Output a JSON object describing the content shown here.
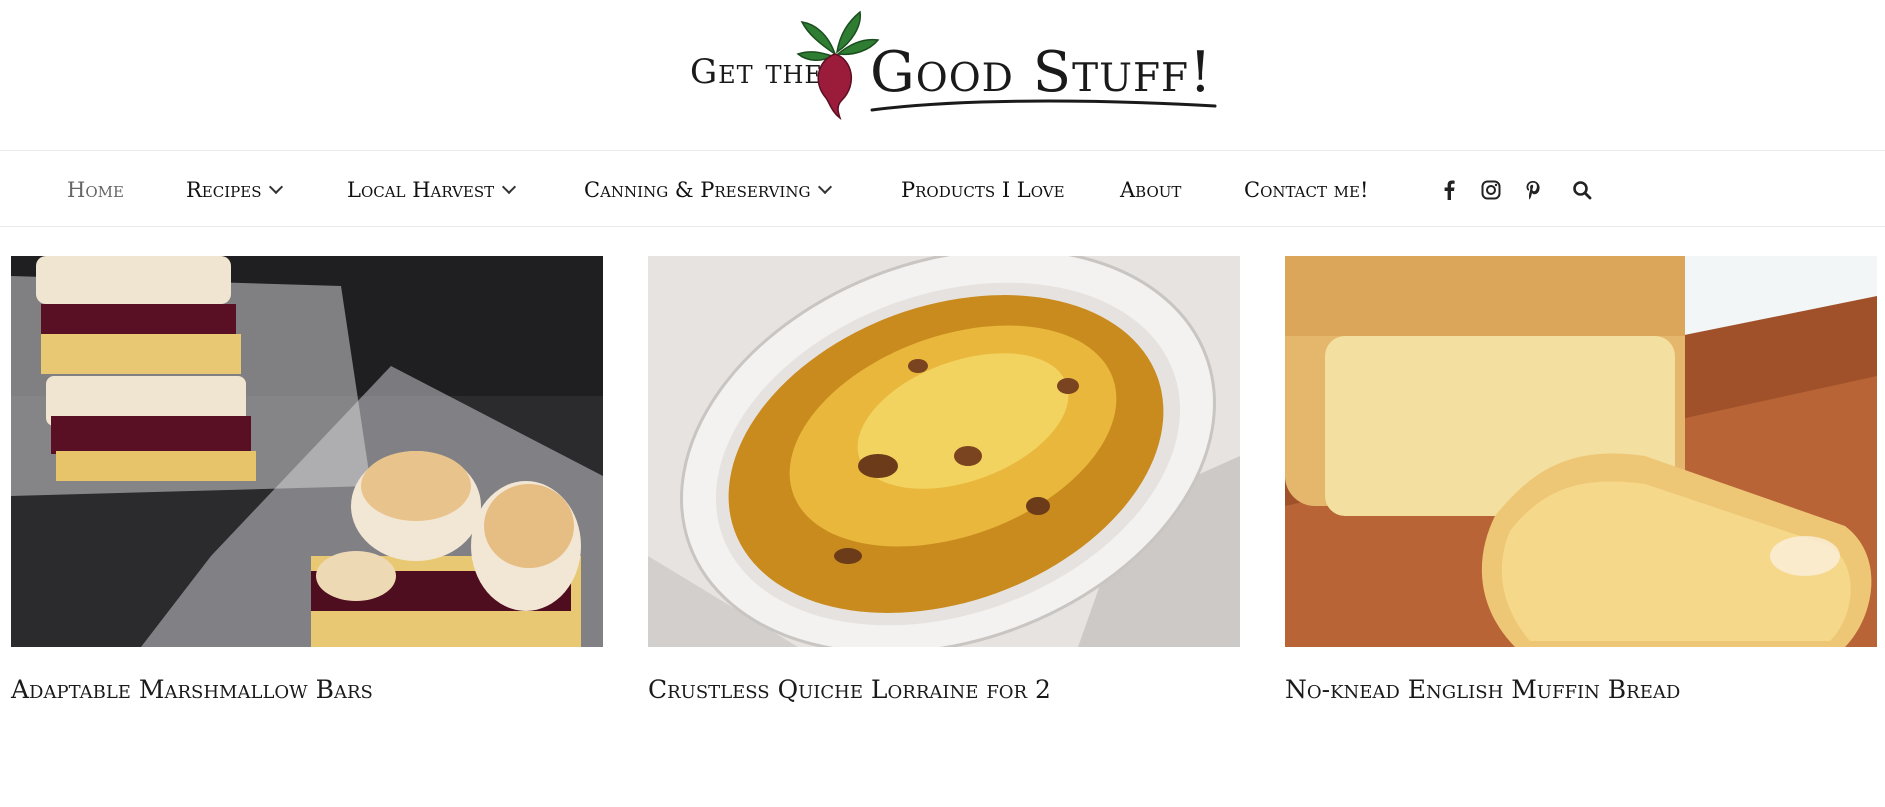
{
  "site": {
    "logo_prefix": "Get the",
    "logo_main": "Good Stuff!"
  },
  "nav": {
    "items": [
      {
        "label": "Home",
        "has_dropdown": false,
        "active": true
      },
      {
        "label": "Recipes",
        "has_dropdown": true,
        "active": false
      },
      {
        "label": "Local Harvest",
        "has_dropdown": true,
        "active": false
      },
      {
        "label": "Canning & Preserving",
        "has_dropdown": true,
        "active": false
      },
      {
        "label": "Products I Love",
        "has_dropdown": false,
        "active": false
      },
      {
        "label": "About",
        "has_dropdown": false,
        "active": false
      },
      {
        "label": "Contact me!",
        "has_dropdown": false,
        "active": false
      }
    ],
    "icons": [
      "facebook-icon",
      "instagram-icon",
      "pinterest-icon",
      "search-icon"
    ]
  },
  "posts": [
    {
      "title": "Adaptable Marshmallow Bars",
      "image": "marshmallow-bars-photo"
    },
    {
      "title": "Crustless Quiche Lorraine for 2",
      "image": "quiche-photo"
    },
    {
      "title": "No-knead English Muffin Bread",
      "image": "muffin-bread-photo"
    }
  ],
  "colors": {
    "beet": "#9b1b3a",
    "leaf": "#2e7d32",
    "text": "#1a1a1a",
    "active_nav": "#666666"
  }
}
